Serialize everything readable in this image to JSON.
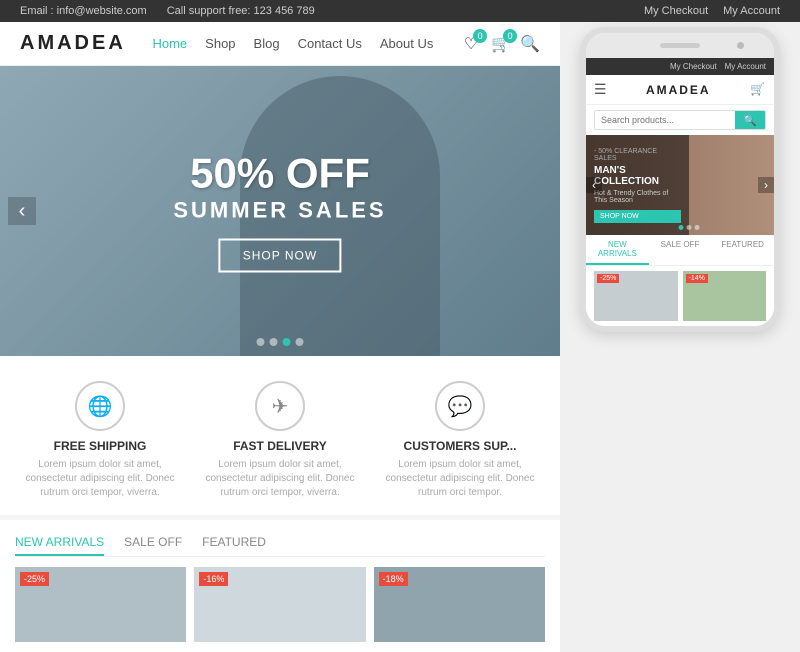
{
  "topbar": {
    "email_label": "Email : info@website.com",
    "support_label": "Call support free: 123 456 789",
    "checkout_label": "My Checkout",
    "account_label": "My Account"
  },
  "header": {
    "logo": "AMADEA",
    "nav": {
      "home": "Home",
      "shop": "Shop",
      "blog": "Blog",
      "contact": "Contact Us",
      "about": "About Us"
    }
  },
  "hero": {
    "discount": "50% OFF",
    "title": "SUMMER SALES",
    "cta": "SHOP NOW",
    "dots": [
      false,
      false,
      true,
      false
    ]
  },
  "features": [
    {
      "icon": "🌐",
      "title": "FREE SHIPPING",
      "desc": "Lorem ipsum dolor sit amet, consectetur adipiscing elit. Donec rutrum orci tempor, viverra."
    },
    {
      "icon": "✈",
      "title": "FAST DELIVERY",
      "desc": "Lorem ipsum dolor sit amet, consectetur adipiscing elit. Donec rutrum orci tempor, viverra."
    },
    {
      "icon": "💬",
      "title": "CUSTOMERS SUP...",
      "desc": "Lorem ipsum dolor sit amet, consectetur adipiscing elit. Donec rutrum orci tempor."
    }
  ],
  "products_tabs": {
    "tabs": [
      "NEW ARRIVALS",
      "SALE OFF",
      "FEATURED"
    ],
    "active": 0,
    "badges": [
      "-25%",
      "-16%",
      "-18%"
    ]
  },
  "phone": {
    "topbar": {
      "checkout": "My Checkout",
      "account": "My Account"
    },
    "logo": "AMADEA",
    "search_placeholder": "Search products...",
    "hero": {
      "tag": "- 50% CLEARANCE SALES",
      "title": "MAN'S COLLECTION",
      "subtitle": "Hot & Trendy Clothes of This Season",
      "cta": "SHOP NOW"
    },
    "tabs": [
      "NEW ARRIVALS",
      "SALE OFF",
      "FEATURED"
    ],
    "active_tab": 0,
    "product_badges": [
      "-25%",
      "-14%"
    ]
  }
}
